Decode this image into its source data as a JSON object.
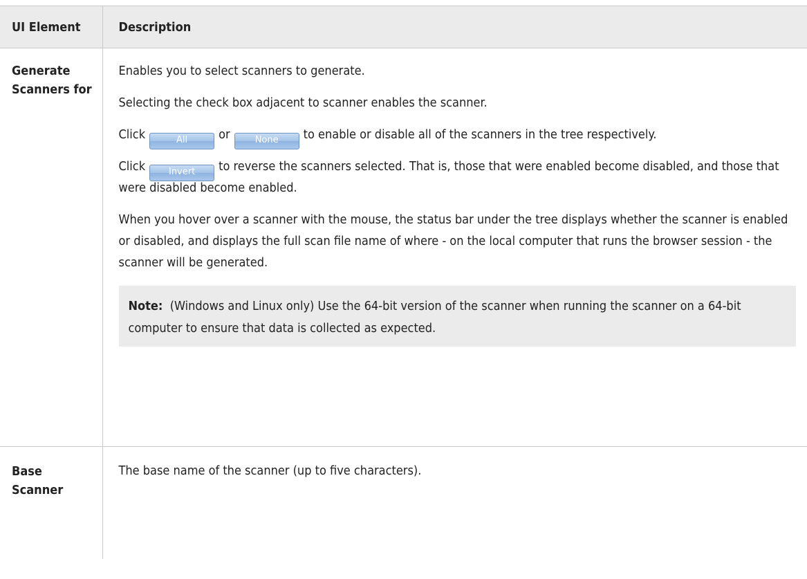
{
  "table": {
    "headers": {
      "col1": "UI Element",
      "col2": "Description"
    },
    "rows": [
      {
        "name": "Generate Scanners for",
        "para1": "Enables you to select scanners to generate.",
        "para2": "Selecting the check box adjacent to scanner enables the scanner.",
        "para3": {
          "pre": "Click",
          "button1_label": "All",
          "mid": "or",
          "button2_label": "None",
          "post": "to enable or disable all of the scanners in the tree respectively."
        },
        "para4": {
          "pre": "Click",
          "button_label": "Invert",
          "post": "to reverse the scanners selected. That is, those that were enabled become disabled, and those that were disabled become enabled."
        },
        "para5": "When you hover over a scanner with the mouse, the status bar under the tree displays whether the scanner is enabled or disabled, and displays the full scan file name of where - on the local computer that runs the browser session - the scanner will be generated.",
        "note": {
          "label": "Note:",
          "text": "(Windows and Linux only) Use the 64-bit version of the scanner when running the scanner on a 64-bit computer to ensure that data is collected as expected."
        }
      },
      {
        "name": "Base Scanner",
        "description": "The base name of the scanner (up to five characters)."
      }
    ]
  }
}
